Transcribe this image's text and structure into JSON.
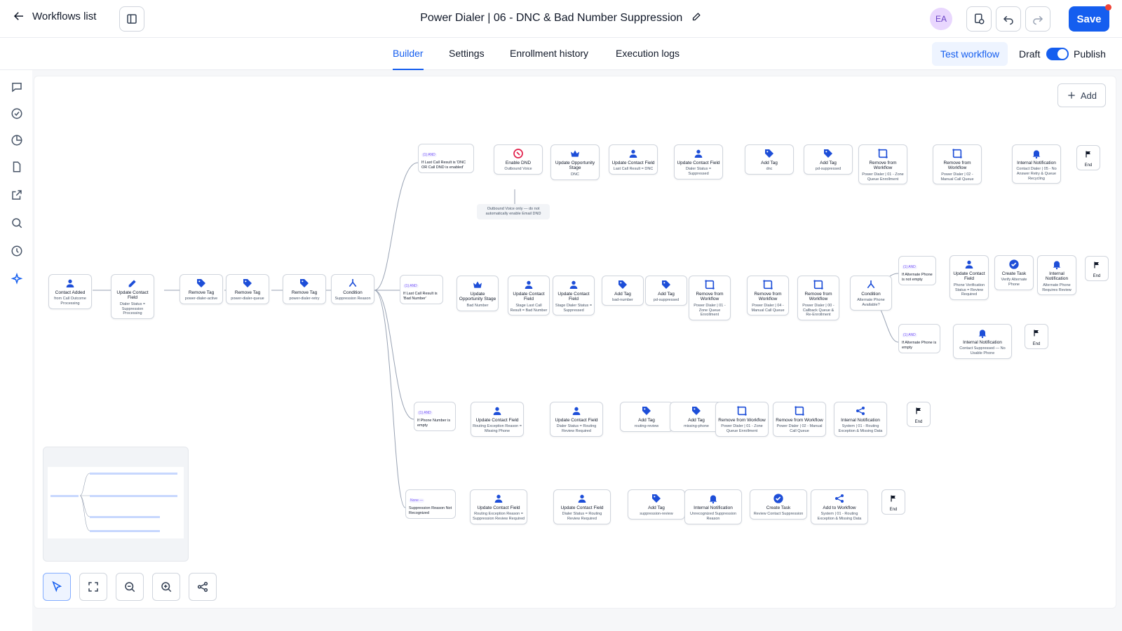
{
  "header": {
    "back_label": "Workflows list",
    "title": "Power Dialer | 06 - DNC & Bad Number Suppression",
    "avatar_initials": "EA",
    "save_label": "Save"
  },
  "tabs": [
    "Builder",
    "Settings",
    "Enrollment history",
    "Execution logs"
  ],
  "active_tab": "Builder",
  "toolbar": {
    "test_label": "Test workflow",
    "draft_label": "Draft",
    "publish_label": "Publish",
    "add_label": "Add"
  },
  "colors": {
    "accent": "#155eef",
    "action_icon": "#1d4ed8",
    "condition_tag": "#7a5af8",
    "dnd_red": "#e11d48"
  },
  "flow": {
    "trunk": [
      {
        "icon": "user-icon",
        "title": "Contact Added",
        "detail": "from Call Outcome Processing"
      },
      {
        "icon": "pencil-icon",
        "title": "Update Contact Field",
        "detail": "Dialer Status = Suppression Processing"
      },
      {
        "icon": "tag-icon",
        "title": "Remove Tag",
        "detail": "power-dialer-active"
      },
      {
        "icon": "tag-icon",
        "title": "Remove Tag",
        "detail": "power-dialer-queue"
      },
      {
        "icon": "tag-icon",
        "title": "Remove Tag",
        "detail": "power-dialer-retry"
      },
      {
        "icon": "branch-icon",
        "title": "Condition",
        "detail": "Suppression Reason"
      }
    ],
    "branch1": {
      "condition": {
        "tag": "(1) AND",
        "text": "If Last Call Result is 'DNC OR Call DND is enabled'"
      },
      "steps": [
        {
          "icon": "dnd-icon",
          "title": "Enable DND",
          "detail": "Outbound Voice"
        },
        {
          "icon": "crown-icon",
          "title": "Update Opportunity Stage",
          "detail": "DNC"
        },
        {
          "icon": "user-icon",
          "title": "Update Contact Field",
          "detail": "Last Call Result = DNC"
        },
        {
          "icon": "user-icon",
          "title": "Update Contact Field",
          "detail": "Dialer Status = Suppressed"
        },
        {
          "icon": "tag-icon",
          "title": "Add Tag",
          "detail": "dnc"
        },
        {
          "icon": "tag-icon",
          "title": "Add Tag",
          "detail": "pd-suppressed"
        },
        {
          "icon": "workflow-icon",
          "title": "Remove from Workflow",
          "detail": "Power Dialer | 01 - Zone Queue Enrollment"
        },
        {
          "icon": "workflow-icon",
          "title": "Remove from Workflow",
          "detail": "Power Dialer | 02 - Manual Call Queue"
        },
        {
          "icon": "bell-icon",
          "title": "Internal Notification",
          "detail": "Contact Dialer | 05 - No Answer Retry & Queue Recycling"
        }
      ],
      "end": "End",
      "note": "Outbound Voice only — do not automatically enable Email DND"
    },
    "branch2": {
      "condition": {
        "tag": "(1) AND",
        "text": "If Last Call Result is 'Bad Number'"
      },
      "steps": [
        {
          "icon": "crown-icon",
          "title": "Update Opportunity Stage",
          "detail": "Bad Number"
        },
        {
          "icon": "user-icon",
          "title": "Update Contact Field",
          "detail": "Stage Last Call Result = Bad Number"
        },
        {
          "icon": "user-icon",
          "title": "Update Contact Field",
          "detail": "Stage Dialer Status = Suppressed"
        },
        {
          "icon": "tag-icon",
          "title": "Add Tag",
          "detail": "bad-number"
        },
        {
          "icon": "tag-icon",
          "title": "Add Tag",
          "detail": "pd-suppressed"
        },
        {
          "icon": "workflow-icon",
          "title": "Remove from Workflow",
          "detail": "Power Dialer | 01 - Zone Queue Enrollment"
        },
        {
          "icon": "workflow-icon",
          "title": "Remove from Workflow",
          "detail": "Power Dialer | 04 - Manual Call Queue"
        },
        {
          "icon": "workflow-icon",
          "title": "Remove from Workflow",
          "detail": "Power Dialer | 00 - Callback Queue & Re-Enrollment"
        },
        {
          "icon": "branch-icon",
          "title": "Condition",
          "detail": "Alternate Phone Available?"
        }
      ],
      "sub_a": {
        "condition": {
          "tag": "(1) AND",
          "text": "If Alternate Phone is not empty"
        },
        "steps": [
          {
            "icon": "user-icon",
            "title": "Update Contact Field",
            "detail": "Phone Verification Status = Review Required"
          },
          {
            "icon": "check-icon",
            "title": "Create Task",
            "detail": "Verify Alternate Phone"
          },
          {
            "icon": "bell-icon",
            "title": "Internal Notification",
            "detail": "Alternate Phone Requires Review"
          }
        ],
        "end": "End"
      },
      "sub_b": {
        "condition": {
          "tag": "(1) AND",
          "text": "If Alternate Phone is empty"
        },
        "steps": [
          {
            "icon": "bell-icon",
            "title": "Internal Notification",
            "detail": "Contact Suppressed — No Usable Phone"
          }
        ],
        "end": "End"
      }
    },
    "branch3": {
      "condition": {
        "tag": "(1) AND",
        "text": "If Phone Number is empty"
      },
      "steps": [
        {
          "icon": "user-icon",
          "title": "Update Contact Field",
          "detail": "Routing Exception Reason = Missing Phone"
        },
        {
          "icon": "user-icon",
          "title": "Update Contact Field",
          "detail": "Dialer Status = Routing Review Required"
        },
        {
          "icon": "tag-icon",
          "title": "Add Tag",
          "detail": "routing-review"
        },
        {
          "icon": "tag-icon",
          "title": "Add Tag",
          "detail": "missing-phone"
        },
        {
          "icon": "workflow-icon",
          "title": "Remove from Workflow",
          "detail": "Power Dialer | 01 - Zone Queue Enrollment"
        },
        {
          "icon": "workflow-icon",
          "title": "Remove from Workflow",
          "detail": "Power Dialer | 02 - Manual Call Queue"
        },
        {
          "icon": "share-icon",
          "title": "Internal Notification",
          "detail": "System | 01 - Routing Exception & Missing Data"
        }
      ],
      "end": "End"
    },
    "branch4": {
      "condition": {
        "tag": "None —",
        "text": "Suppression Reason Not Recognized"
      },
      "steps": [
        {
          "icon": "user-icon",
          "title": "Update Contact Field",
          "detail": "Routing Exception Reason = Suppression Review Required"
        },
        {
          "icon": "user-icon",
          "title": "Update Contact Field",
          "detail": "Dialer Status = Routing Review Required"
        },
        {
          "icon": "tag-icon",
          "title": "Add Tag",
          "detail": "suppression-review"
        },
        {
          "icon": "bell-icon",
          "title": "Internal Notification",
          "detail": "Unrecognized Suppression Reason"
        },
        {
          "icon": "check-icon",
          "title": "Create Task",
          "detail": "Review Contact Suppression"
        },
        {
          "icon": "share-icon",
          "title": "Add to Workflow",
          "detail": "System | 01 - Routing Exception & Missing Data"
        }
      ],
      "end": "End"
    }
  }
}
